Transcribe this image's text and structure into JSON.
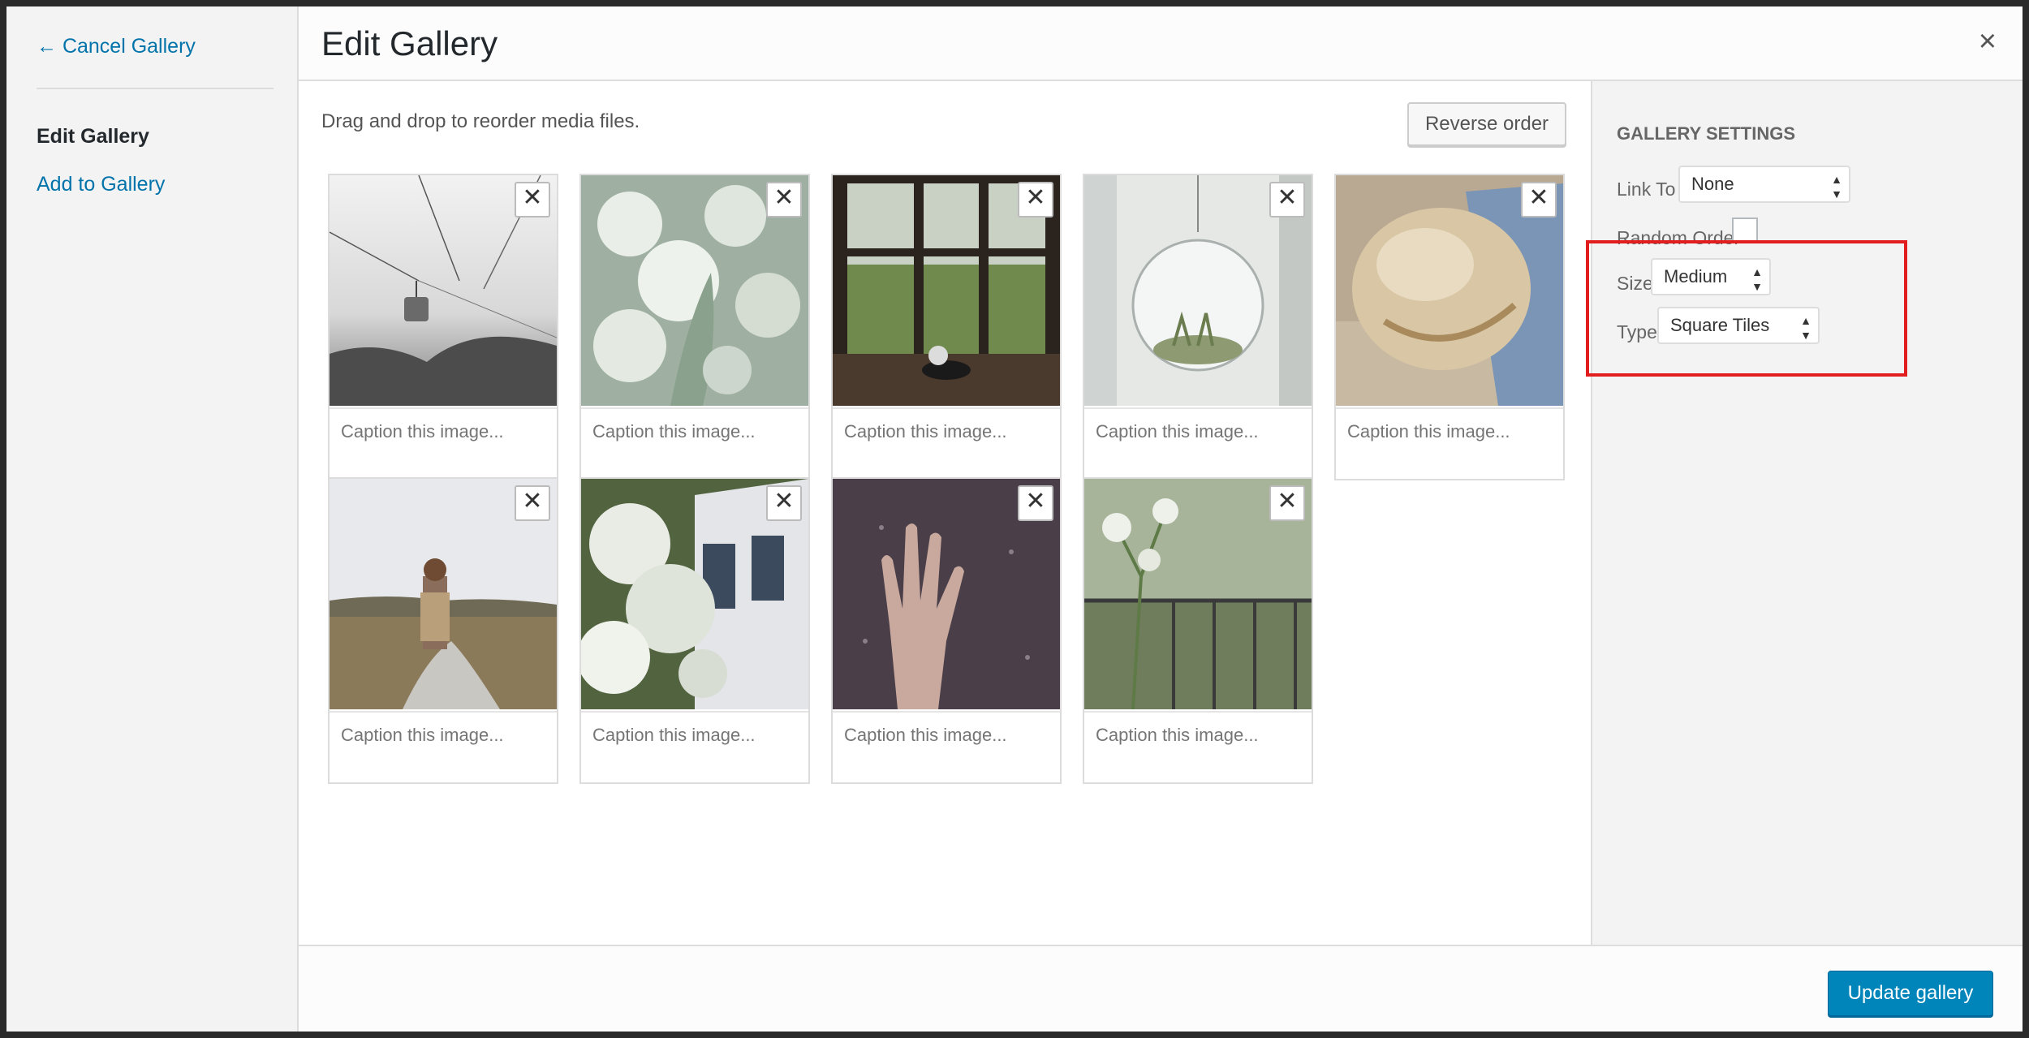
{
  "menu": {
    "cancel_label": "← Cancel Gallery",
    "active_item": "Edit Gallery",
    "add_item": "Add to Gallery"
  },
  "header": {
    "title": "Edit Gallery",
    "close_symbol": "×"
  },
  "content": {
    "hint": "Drag and drop to reorder media files.",
    "reverse_label": "Reverse order",
    "caption_placeholder": "Caption this image...",
    "remove_symbol": "✕",
    "images": [
      {
        "name": "cable-car-fog"
      },
      {
        "name": "white-flowers"
      },
      {
        "name": "window-sill"
      },
      {
        "name": "hanging-terrarium"
      },
      {
        "name": "bread-loaf"
      },
      {
        "name": "woman-on-road"
      },
      {
        "name": "white-house-blossoms"
      },
      {
        "name": "hand-on-wet-glass"
      },
      {
        "name": "flowers-on-balcony"
      }
    ]
  },
  "settings": {
    "heading": "GALLERY SETTINGS",
    "link_to_label": "Link To",
    "link_to_value": "None",
    "random_order_label": "Random Order",
    "size_label": "Size",
    "size_value": "Medium",
    "type_label": "Type",
    "type_value": "Square Tiles",
    "highlight_color": "#e21d1d"
  },
  "footer": {
    "update_label": "Update gallery",
    "accent": "#0085ba"
  }
}
